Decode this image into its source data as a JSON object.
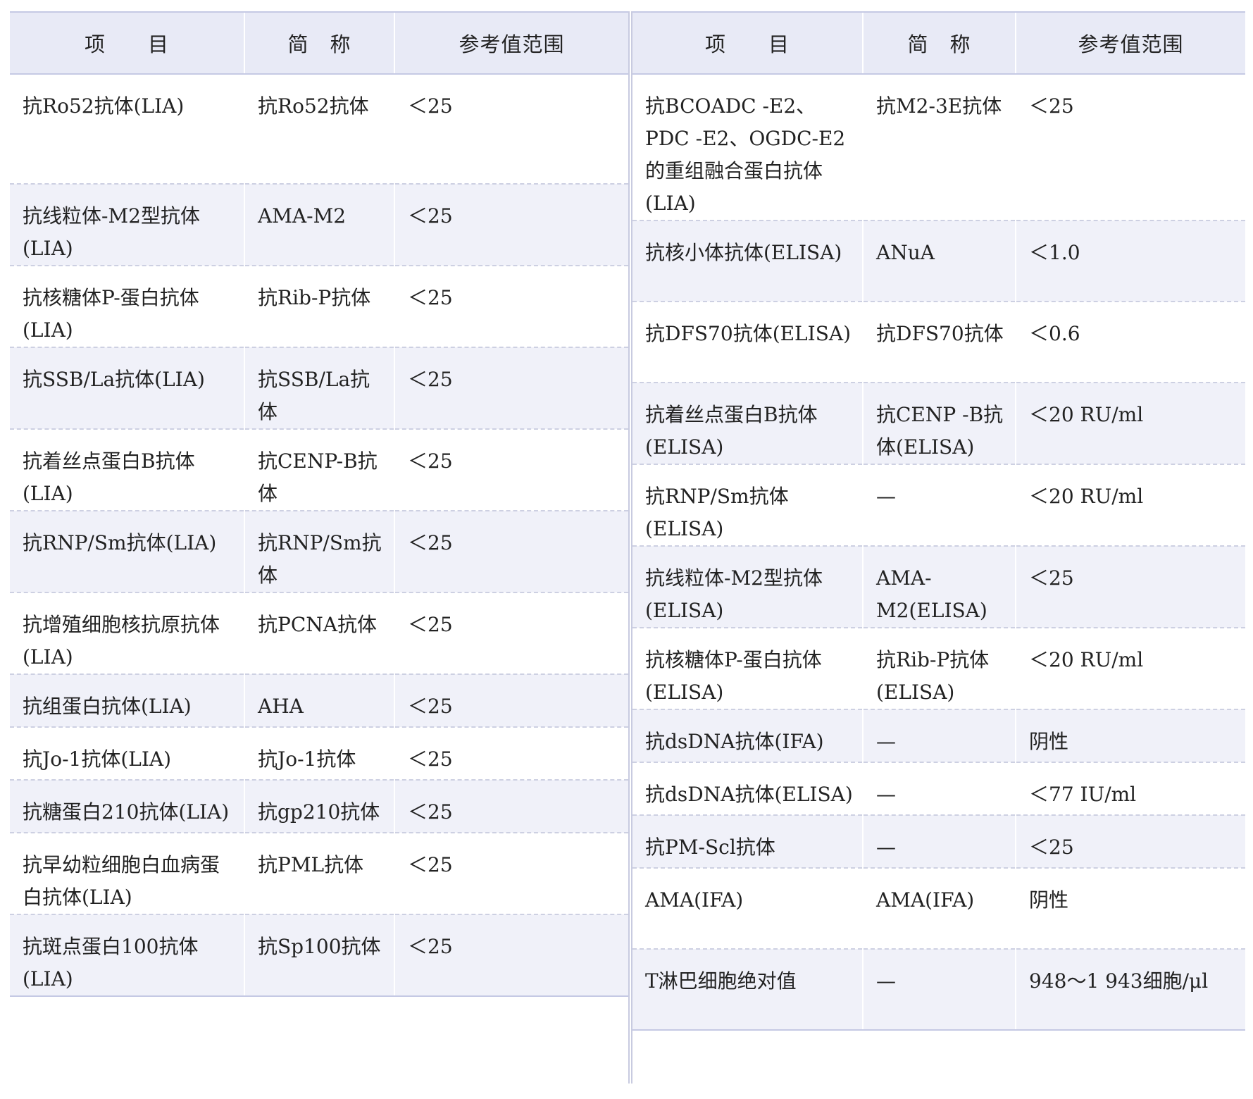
{
  "headers": {
    "left": [
      "项　　目",
      "简　称",
      "参考值范围"
    ],
    "right": [
      "项　　目",
      "简　称",
      "参考值范围"
    ]
  },
  "rows": [
    {
      "left": [
        "抗Ro52抗体(LIA)",
        "抗Ro52抗体",
        "＜25"
      ],
      "right": [
        "抗BCOADC -E2、PDC -E2、OGDC-E2的重组融合蛋白抗体(LIA)",
        "抗M2-3E抗体",
        "＜25"
      ]
    },
    {
      "left": [
        "抗线粒体-M2型抗体(LIA)",
        "AMA-M2",
        "＜25"
      ],
      "right": [
        "抗核小体抗体(ELISA)",
        "ANuA",
        "＜1.0"
      ]
    },
    {
      "left": [
        "抗核糖体P-蛋白抗体(LIA)",
        "抗Rib-P抗体",
        "＜25"
      ],
      "right": [
        "抗DFS70抗体(ELISA)",
        "抗DFS70抗体",
        "＜0.6"
      ]
    },
    {
      "left": [
        "抗SSB/La抗体(LIA)",
        "抗SSB/La抗体",
        "＜25"
      ],
      "right": [
        "抗着丝点蛋白B抗体(ELISA)",
        "抗CENP -B抗 体(ELISA)",
        "＜20 RU/ml"
      ]
    },
    {
      "left": [
        "抗着丝点蛋白B抗体(LIA)",
        "抗CENP-B抗体",
        "＜25"
      ],
      "right": [
        "抗RNP/Sm抗体(ELISA)",
        "—",
        "＜20 RU/ml"
      ]
    },
    {
      "left": [
        "抗RNP/Sm抗体(LIA)",
        "抗RNP/Sm抗体",
        "＜25"
      ],
      "right": [
        "抗线粒体-M2型抗体(ELISA)",
        "AMA-M2(ELISA)",
        "＜25"
      ]
    },
    {
      "left": [
        "抗增殖细胞核抗原抗体(LIA)",
        "抗PCNA抗体",
        "＜25"
      ],
      "right": [
        "抗核糖体P-蛋白抗体(ELISA)",
        "抗Rib-P抗体(ELISA)",
        "＜20 RU/ml"
      ]
    },
    {
      "left": [
        "抗组蛋白抗体(LIA)",
        "AHA",
        "＜25"
      ],
      "right": [
        "抗dsDNA抗体(IFA)",
        "—",
        "阴性"
      ]
    },
    {
      "left": [
        "抗Jo-1抗体(LIA)",
        "抗Jo-1抗体",
        "＜25"
      ],
      "right": [
        "抗dsDNA抗体(ELISA)",
        "—",
        "＜77 IU/ml"
      ]
    },
    {
      "left": [
        "抗糖蛋白210抗体(LIA)",
        "抗gp210抗体",
        "＜25"
      ],
      "right": [
        "抗PM-Scl抗体",
        "—",
        "＜25"
      ]
    },
    {
      "left": [
        "抗早幼粒细胞白血病蛋白抗体(LIA)",
        "抗PML抗体",
        "＜25"
      ],
      "right": [
        "AMA(IFA)",
        "AMA(IFA)",
        "阴性"
      ]
    },
    {
      "left": [
        "抗斑点蛋白100抗体(LIA)",
        "抗Sp100抗体",
        "＜25"
      ],
      "right": [
        "T淋巴细胞绝对值",
        "—",
        "948～1 943细胞/μl"
      ]
    }
  ]
}
